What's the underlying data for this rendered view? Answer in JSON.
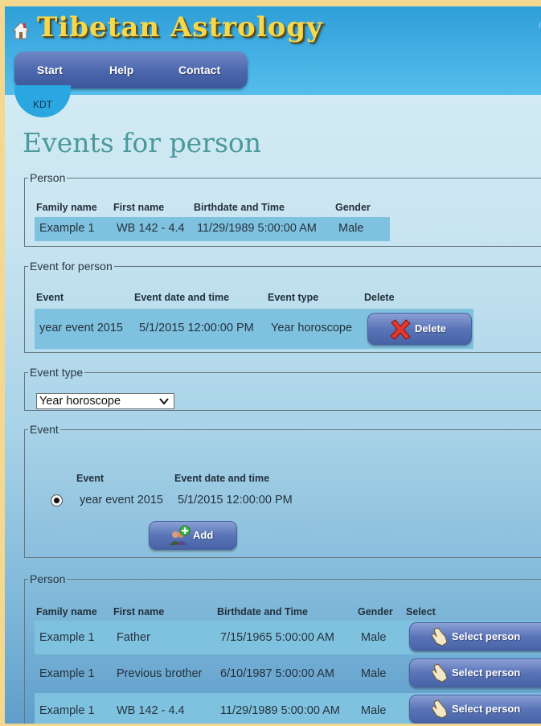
{
  "header": {
    "app_title": "Tibetan Astrology",
    "right_marker": "I",
    "nav": [
      "Start",
      "Help",
      "Contact"
    ],
    "badge": "KDT"
  },
  "page_title": "Events for person",
  "person_section": {
    "legend": "Person",
    "columns": [
      "Family name",
      "First name",
      "Birthdate and Time",
      "Gender"
    ],
    "row": {
      "family_name": "Example 1",
      "first_name": "WB 142 - 4.4",
      "birthdate": "11/29/1989 5:00:00 AM",
      "gender": "Male"
    }
  },
  "event_for_person": {
    "legend": "Event for person",
    "columns": [
      "Event",
      "Event date and time",
      "Event type",
      "Delete"
    ],
    "row": {
      "event": "year event 2015",
      "date": "5/1/2015 12:00:00 PM",
      "type": "Year horoscope",
      "delete_label": "Delete"
    }
  },
  "event_type": {
    "legend": "Event type",
    "selected": "Year horoscope"
  },
  "event_section": {
    "legend": "Event",
    "columns": [
      "Event",
      "Event date and time"
    ],
    "row": {
      "event": "year event 2015",
      "date": "5/1/2015 12:00:00 PM",
      "selected": true
    },
    "add_label": "Add"
  },
  "persons_list": {
    "legend": "Person",
    "columns": [
      "Family name",
      "First name",
      "Birthdate and Time",
      "Gender",
      "Select"
    ],
    "select_label": "Select person",
    "rows": [
      {
        "family_name": "Example 1",
        "first_name": "Father",
        "birthdate": "7/15/1965 5:00:00 AM",
        "gender": "Male"
      },
      {
        "family_name": "Example 1",
        "first_name": "Previous brother",
        "birthdate": "6/10/1987 5:00:00 AM",
        "gender": "Male"
      },
      {
        "family_name": "Example 1",
        "first_name": "WB 142 - 4.4",
        "birthdate": "11/29/1989 5:00:00 AM",
        "gender": "Male"
      }
    ]
  },
  "colors": {
    "header_blue": "#3aaee2",
    "title_gold": "#f7d84a",
    "page_title_teal": "#4a9a9b",
    "row_highlight": "#7fc2e0",
    "button_blue": "#5a74b8"
  }
}
